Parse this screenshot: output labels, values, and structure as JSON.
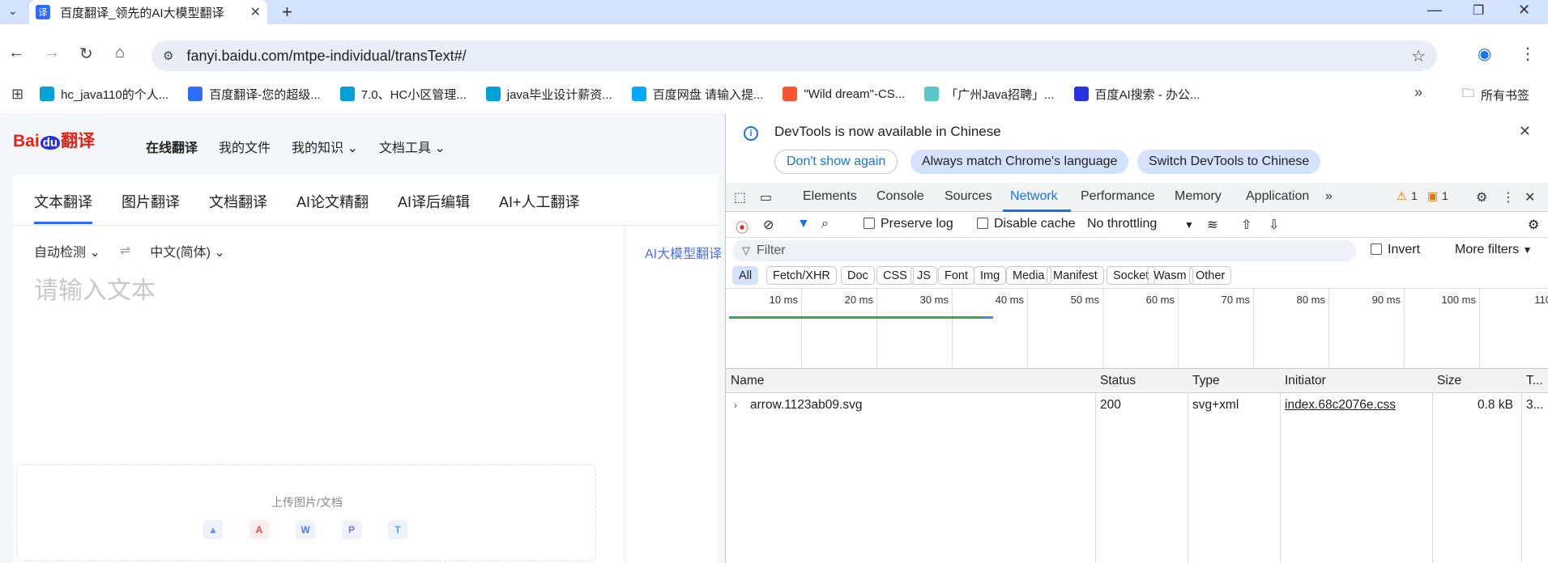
{
  "tab": {
    "title": "百度翻译_领先的AI大模型翻译",
    "favicon": "译"
  },
  "address": {
    "url": "fanyi.baidu.com/mtpe-individual/transText#/"
  },
  "bookmarks": [
    {
      "label": "hc_java110的个人...",
      "color": "#00a1d6"
    },
    {
      "label": "百度翻译-您的超级...",
      "color": "#2f6bff"
    },
    {
      "label": "7.0、HC小区管理...",
      "color": "#00a1d6"
    },
    {
      "label": "java毕业设计薪资...",
      "color": "#00a1d6"
    },
    {
      "label": "百度网盘 请输入提...",
      "color": "#06a7ff"
    },
    {
      "label": "\"Wild dream\"-CS...",
      "color": "#fc5531"
    },
    {
      "label": "「广州Java招聘」...",
      "color": "#5ac8c8"
    },
    {
      "label": "百度AI搜索 - 办公...",
      "color": "#2932e1"
    }
  ],
  "bookmarks_all": "所有书签",
  "site": {
    "logo_prefix": "Bai",
    "logo_du": "du",
    "logo_suffix": "翻译",
    "nav": [
      "在线翻译",
      "我的文件",
      "我的知识 ⌄",
      "文档工具 ⌄"
    ],
    "subtabs": [
      "文本翻译",
      "图片翻译",
      "文档翻译",
      "AI论文精翻",
      "AI译后编辑",
      "AI+人工翻译"
    ],
    "source_lang": "自动检测 ⌄",
    "swap": "⇌",
    "target_lang": "中文(简体) ⌄",
    "placeholder": "请输入文本",
    "ai_tag": "AI大模型翻译",
    "upload_label": "上传图片/文档"
  },
  "devtools": {
    "info_message": "DevTools is now available in Chinese",
    "btn_dont_show": "Don't show again",
    "btn_always_match": "Always match Chrome's language",
    "btn_switch": "Switch DevTools to Chinese",
    "tabs": [
      "Elements",
      "Console",
      "Sources",
      "Network",
      "Performance",
      "Memory",
      "Application"
    ],
    "active_tab": "Network",
    "warn_count": "1",
    "issue_count": "1",
    "preserve_log": "Preserve log",
    "disable_cache": "Disable cache",
    "throttling": "No throttling",
    "filter_placeholder": "Filter",
    "invert": "Invert",
    "more_filters": "More filters",
    "type_filters": [
      "All",
      "Fetch/XHR",
      "Doc",
      "CSS",
      "JS",
      "Font",
      "Img",
      "Media",
      "Manifest",
      "Socket",
      "Wasm",
      "Other"
    ],
    "timeline_ticks": [
      "10 ms",
      "20 ms",
      "30 ms",
      "40 ms",
      "50 ms",
      "60 ms",
      "70 ms",
      "80 ms",
      "90 ms",
      "100 ms",
      "110"
    ],
    "columns": [
      "Name",
      "Status",
      "Type",
      "Initiator",
      "Size",
      "T..."
    ],
    "rows": [
      {
        "name": "arrow.1123ab09.svg",
        "status": "200",
        "type": "svg+xml",
        "initiator": "index.68c2076e.css",
        "size": "0.8 kB",
        "time": "3..."
      }
    ]
  }
}
